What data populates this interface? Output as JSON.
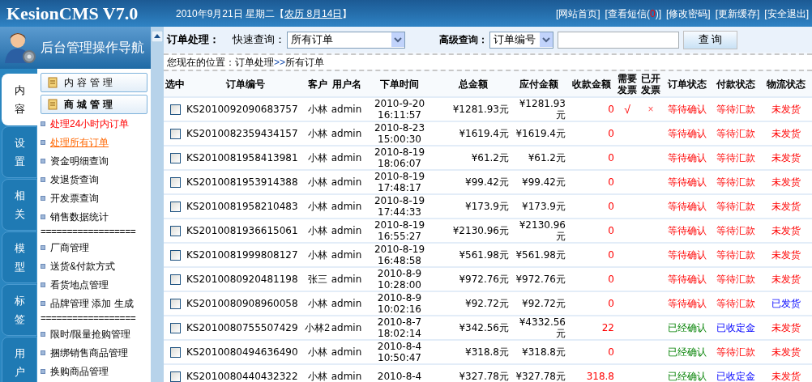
{
  "header": {
    "logo": "KesionCMS V7.0",
    "date": "2010年9月21日 星期二【",
    "lunar": "农历 8月14日",
    "date_end": "】",
    "links": [
      {
        "text": "[网站首页]"
      },
      {
        "text": "[查看短信(",
        "count": "0",
        "after": ")]"
      },
      {
        "text": "[修改密码]"
      },
      {
        "text": "[更新缓存]"
      },
      {
        "text": "[安全退出]"
      }
    ]
  },
  "sidebar": {
    "title": "后台管理操作导航",
    "tabs": [
      {
        "label": "内容",
        "selected": true
      },
      {
        "label": "设置",
        "selected": false
      },
      {
        "label": "相关",
        "selected": false
      },
      {
        "label": "模型",
        "selected": false
      },
      {
        "label": "标签",
        "selected": false
      },
      {
        "label": "用户",
        "selected": false
      }
    ],
    "groups": [
      {
        "label": "内容管理",
        "selected": false
      },
      {
        "label": "商城管理",
        "selected": true
      }
    ],
    "items": [
      {
        "kind": "link",
        "text": "处理24小时内订单",
        "highlight": true,
        "selected": false
      },
      {
        "kind": "link",
        "text": "处理所有订单",
        "highlight": false,
        "selected": true
      },
      {
        "kind": "link",
        "text": "资金明细查询",
        "highlight": false,
        "selected": false
      },
      {
        "kind": "link",
        "text": "发退货查询",
        "highlight": false,
        "selected": false
      },
      {
        "kind": "link",
        "text": "开发票查询",
        "highlight": false,
        "selected": false
      },
      {
        "kind": "link",
        "text": "销售数据统计",
        "highlight": false,
        "selected": false
      },
      {
        "kind": "separator",
        "text": "=================="
      },
      {
        "kind": "link",
        "text": "厂商管理",
        "highlight": false,
        "selected": false
      },
      {
        "kind": "link",
        "text": "送货&付款方式",
        "highlight": false,
        "selected": false
      },
      {
        "kind": "link",
        "text": "看货地点管理",
        "highlight": false,
        "selected": false
      },
      {
        "kind": "link",
        "text": "品牌管理 添加 生成",
        "highlight": false,
        "selected": false
      },
      {
        "kind": "separator",
        "text": "=================="
      },
      {
        "kind": "link",
        "text": "限时/限量抢购管理",
        "highlight": false,
        "selected": false
      },
      {
        "kind": "link",
        "text": "捆绑销售商品管理",
        "highlight": false,
        "selected": false
      },
      {
        "kind": "link",
        "text": "换购商品管理",
        "highlight": false,
        "selected": false
      }
    ]
  },
  "toolbar": {
    "title": "订单处理：",
    "quick_label": "快速查询：",
    "quick_value": "所有订单",
    "advanced_label": "高级查询：",
    "advanced_value": "订单编号",
    "search_button": "查 询"
  },
  "breadcrumb": {
    "text": "您现在的位置：订单处理",
    "sep": ">>",
    "current": "所有订单"
  },
  "table": {
    "columns": [
      "选中",
      "订单编号",
      "客户",
      "用户名",
      "下单时间",
      "总金额",
      "应付金额",
      "收款金额",
      "需要发票",
      "已开发票",
      "订单状态",
      "付款状态",
      "物流状态"
    ],
    "rows": [
      {
        "checked": false,
        "order": "KS2010092090683757",
        "customer": "小林",
        "user": "admin",
        "time": [
          "2010-9-20",
          "16:11:57"
        ],
        "total": "¥1281.93元",
        "payable": "¥1281.93元",
        "received": "0",
        "need_invoice": "√",
        "issued": "×",
        "order_status": {
          "text": "等待确认",
          "kind": "alert"
        },
        "pay_status": {
          "text": "等待汇款",
          "kind": "alert"
        },
        "ship_status": {
          "text": "未发货",
          "kind": "alert"
        }
      },
      {
        "checked": false,
        "order": "KS2010082359434157",
        "customer": "小林",
        "user": "admin",
        "time": [
          "2010-8-23",
          "15:00:30"
        ],
        "total": "¥1619.4元",
        "payable": "¥1619.4元",
        "received": "0",
        "order_status": {
          "text": "等待确认",
          "kind": "alert"
        },
        "pay_status": {
          "text": "等待汇款",
          "kind": "alert"
        },
        "ship_status": {
          "text": "未发货",
          "kind": "alert"
        }
      },
      {
        "checked": false,
        "order": "KS2010081958413981",
        "customer": "小林",
        "user": "admin",
        "time": [
          "2010-8-19",
          "18:06:07"
        ],
        "total": "¥61.2元",
        "payable": "¥61.2元",
        "received": "0",
        "order_status": {
          "text": "等待确认",
          "kind": "alert"
        },
        "pay_status": {
          "text": "等待汇款",
          "kind": "alert"
        },
        "ship_status": {
          "text": "未发货",
          "kind": "alert"
        }
      },
      {
        "checked": false,
        "order": "KS2010081953914388",
        "customer": "小林",
        "user": "admin",
        "time": [
          "2010-8-19",
          "17:48:17"
        ],
        "total": "¥99.42元",
        "payable": "¥99.42元",
        "received": "0",
        "order_status": {
          "text": "等待确认",
          "kind": "alert"
        },
        "pay_status": {
          "text": "等待汇款",
          "kind": "alert"
        },
        "ship_status": {
          "text": "未发货",
          "kind": "alert"
        }
      },
      {
        "checked": false,
        "order": "KS2010081958210483",
        "customer": "小林",
        "user": "admin",
        "time": [
          "2010-8-19",
          "17:44:33"
        ],
        "total": "¥173.9元",
        "payable": "¥173.9元",
        "received": "0",
        "order_status": {
          "text": "等待确认",
          "kind": "alert"
        },
        "pay_status": {
          "text": "等待汇款",
          "kind": "alert"
        },
        "ship_status": {
          "text": "未发货",
          "kind": "alert"
        }
      },
      {
        "checked": false,
        "order": "KS2010081936615061",
        "customer": "小林",
        "user": "admin",
        "time": [
          "2010-8-19",
          "16:55:27"
        ],
        "total": "¥2130.96元",
        "payable": "¥2130.96元",
        "received": "0",
        "order_status": {
          "text": "等待确认",
          "kind": "alert"
        },
        "pay_status": {
          "text": "等待汇款",
          "kind": "alert"
        },
        "ship_status": {
          "text": "未发货",
          "kind": "alert"
        }
      },
      {
        "checked": false,
        "order": "KS2010081999808127",
        "customer": "小林",
        "user": "admin",
        "time": [
          "2010-8-19",
          "16:48:58"
        ],
        "total": "¥561.98元",
        "payable": "¥561.98元",
        "received": "0",
        "order_status": {
          "text": "等待确认",
          "kind": "alert"
        },
        "pay_status": {
          "text": "等待汇款",
          "kind": "alert"
        },
        "ship_status": {
          "text": "未发货",
          "kind": "alert"
        }
      },
      {
        "checked": false,
        "order": "KS2010080920481198",
        "customer": "张三",
        "user": "admin",
        "time": [
          "2010-8-9",
          "10:28:00"
        ],
        "total": "¥972.76元",
        "payable": "¥972.76元",
        "received": "0",
        "order_status": {
          "text": "等待确认",
          "kind": "alert"
        },
        "pay_status": {
          "text": "等待汇款",
          "kind": "alert"
        },
        "ship_status": {
          "text": "未发货",
          "kind": "alert"
        }
      },
      {
        "checked": false,
        "order": "KS2010080908960058",
        "customer": "小林",
        "user": "admin",
        "time": [
          "2010-8-9",
          "10:02:16"
        ],
        "total": "¥92.72元",
        "payable": "¥92.72元",
        "received": "0",
        "order_status": {
          "text": "等待确认",
          "kind": "alert"
        },
        "pay_status": {
          "text": "等待汇款",
          "kind": "alert"
        },
        "ship_status": {
          "text": "已发货",
          "kind": "info"
        }
      },
      {
        "checked": false,
        "order": "KS2010080755507429",
        "customer": "小林2",
        "user": "admin",
        "time": [
          "2010-8-7",
          "18:02:14"
        ],
        "total": "¥342.56元",
        "payable": "¥4332.56元",
        "received": "22",
        "order_status": {
          "text": "已经确认",
          "kind": "ok"
        },
        "pay_status": {
          "text": "已收定金",
          "kind": "info"
        },
        "ship_status": {
          "text": "未发货",
          "kind": "alert"
        }
      },
      {
        "checked": false,
        "order": "KS2010080494636490",
        "customer": "小林",
        "user": "admin",
        "time": [
          "2010-8-4",
          "10:50:47"
        ],
        "total": "¥318.8元",
        "payable": "¥318.8元",
        "received": "0",
        "order_status": {
          "text": "已经确认",
          "kind": "ok"
        },
        "pay_status": {
          "text": "等待汇款",
          "kind": "alert"
        },
        "ship_status": {
          "text": "未发货",
          "kind": "alert"
        }
      },
      {
        "checked": false,
        "order": "KS2010080440432322",
        "customer": "小林",
        "user": "admin",
        "time": [
          "2010-8-4"
        ],
        "total": "¥327.78元",
        "payable": "¥327.78元",
        "received": "318.8",
        "order_status": {
          "text": "已经确认",
          "kind": "ok"
        },
        "pay_status": {
          "text": "已收定金",
          "kind": "info"
        },
        "ship_status": {
          "text": "未发货",
          "kind": "alert"
        }
      }
    ]
  }
}
